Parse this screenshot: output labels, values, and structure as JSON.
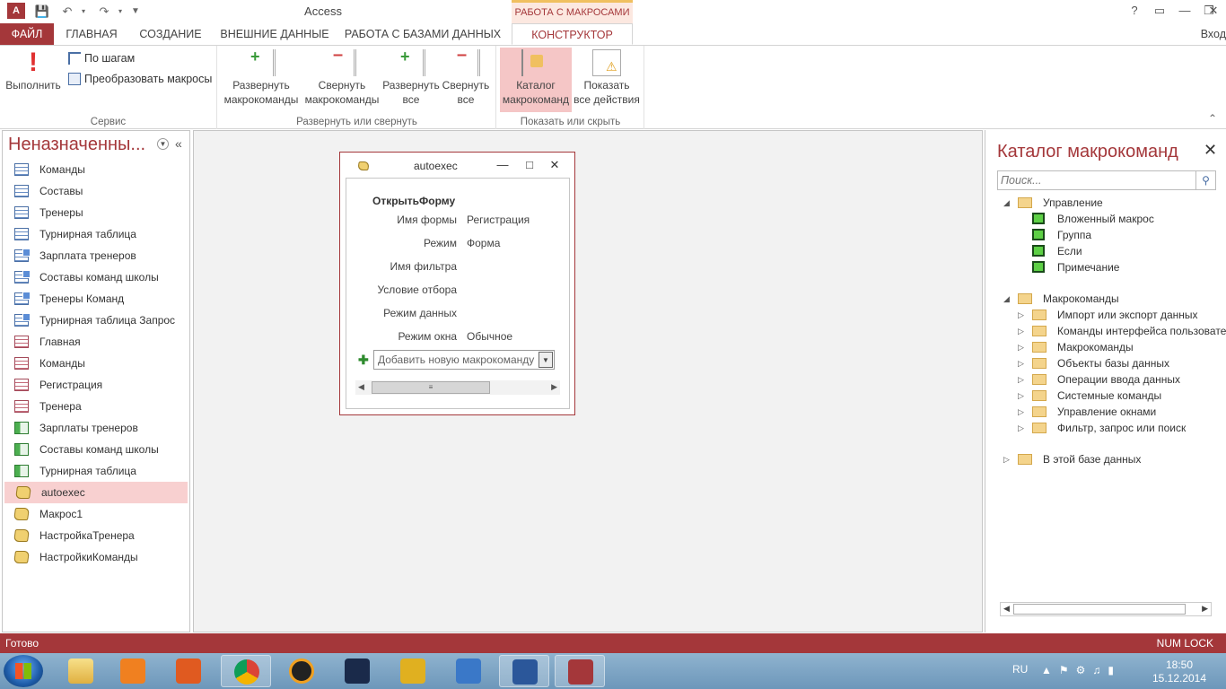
{
  "window": {
    "title": "Access",
    "logo": "A",
    "context_tab_group": "РАБОТА С МАКРОСАМИ",
    "help": "?",
    "signin": "Вход"
  },
  "tabs": [
    "ФАЙЛ",
    "ГЛАВНАЯ",
    "СОЗДАНИЕ",
    "ВНЕШНИЕ ДАННЫЕ",
    "РАБОТА С БАЗАМИ ДАННЫХ",
    "КОНСТРУКТОР"
  ],
  "ribbon": {
    "service": {
      "label": "Сервис",
      "run": "Выполнить",
      "step": "По шагам",
      "convert": "Преобразовать макросы"
    },
    "expand": {
      "label": "Развернуть или свернуть",
      "expand_actions_1": "Развернуть",
      "expand_actions_2": "макрокоманды",
      "collapse_actions_1": "Свернуть",
      "collapse_actions_2": "макрокоманды",
      "expand_all_1": "Развернуть",
      "expand_all_2": "все",
      "collapse_all_1": "Свернуть",
      "collapse_all_2": "все"
    },
    "show": {
      "label": "Показать или скрыть",
      "catalog_1": "Каталог",
      "catalog_2": "макрокоманд",
      "show_all_1": "Показать",
      "show_all_2": "все действия"
    }
  },
  "navpane": {
    "header": "Неназначенны...",
    "items": [
      {
        "label": "Команды",
        "type": "table"
      },
      {
        "label": "Составы",
        "type": "table"
      },
      {
        "label": "Тренеры",
        "type": "table"
      },
      {
        "label": "Турнирная таблица",
        "type": "table"
      },
      {
        "label": "Зарплата тренеров",
        "type": "query"
      },
      {
        "label": "Составы команд школы",
        "type": "query"
      },
      {
        "label": "Тренеры Команд",
        "type": "query"
      },
      {
        "label": "Турнирная таблица Запрос",
        "type": "query"
      },
      {
        "label": "Главная",
        "type": "form"
      },
      {
        "label": "Команды",
        "type": "form"
      },
      {
        "label": "Регистрация",
        "type": "form"
      },
      {
        "label": "Тренера",
        "type": "form"
      },
      {
        "label": "Зарплаты тренеров",
        "type": "report"
      },
      {
        "label": "Составы команд школы",
        "type": "report"
      },
      {
        "label": "Турнирная таблица",
        "type": "report"
      },
      {
        "label": "autoexec",
        "type": "macro",
        "selected": true
      },
      {
        "label": "Макрос1",
        "type": "macro"
      },
      {
        "label": "НастройкаТренера",
        "type": "macro"
      },
      {
        "label": "НастройкиКоманды",
        "type": "macro"
      }
    ]
  },
  "macro_window": {
    "title": "autoexec",
    "action": "ОткрытьФорму",
    "args": [
      {
        "label": "Имя формы",
        "value": "Регистрация"
      },
      {
        "label": "Режим",
        "value": "Форма"
      },
      {
        "label": "Имя фильтра",
        "value": ""
      },
      {
        "label": "Условие отбора",
        "value": ""
      },
      {
        "label": "Режим данных",
        "value": ""
      },
      {
        "label": "Режим окна",
        "value": "Обычное"
      }
    ],
    "add_placeholder": "Добавить новую макрокоманду"
  },
  "catalog": {
    "title": "Каталог макрокоманд",
    "search_placeholder": "Поиск...",
    "groups": [
      {
        "label": "Управление",
        "expanded": true,
        "children": [
          "Вложенный макрос",
          "Группа",
          "Если",
          "Примечание"
        ]
      },
      {
        "label": "Макрокоманды",
        "expanded": true,
        "children": [
          "Импорт или экспорт данных",
          "Команды интерфейса пользовате",
          "Макрокоманды",
          "Объекты базы данных",
          "Операции ввода данных",
          "Системные команды",
          "Управление окнами",
          "Фильтр, запрос или поиск"
        ]
      },
      {
        "label": "В этой базе данных",
        "expanded": false,
        "children": []
      }
    ]
  },
  "status": {
    "left": "Готово",
    "right": "NUM LOCK"
  },
  "taskbar": {
    "lang": "RU",
    "time": "18:50",
    "date": "15.12.2014"
  },
  "colors": {
    "accent": "#a4373a",
    "selected": "#f8d0d0"
  }
}
